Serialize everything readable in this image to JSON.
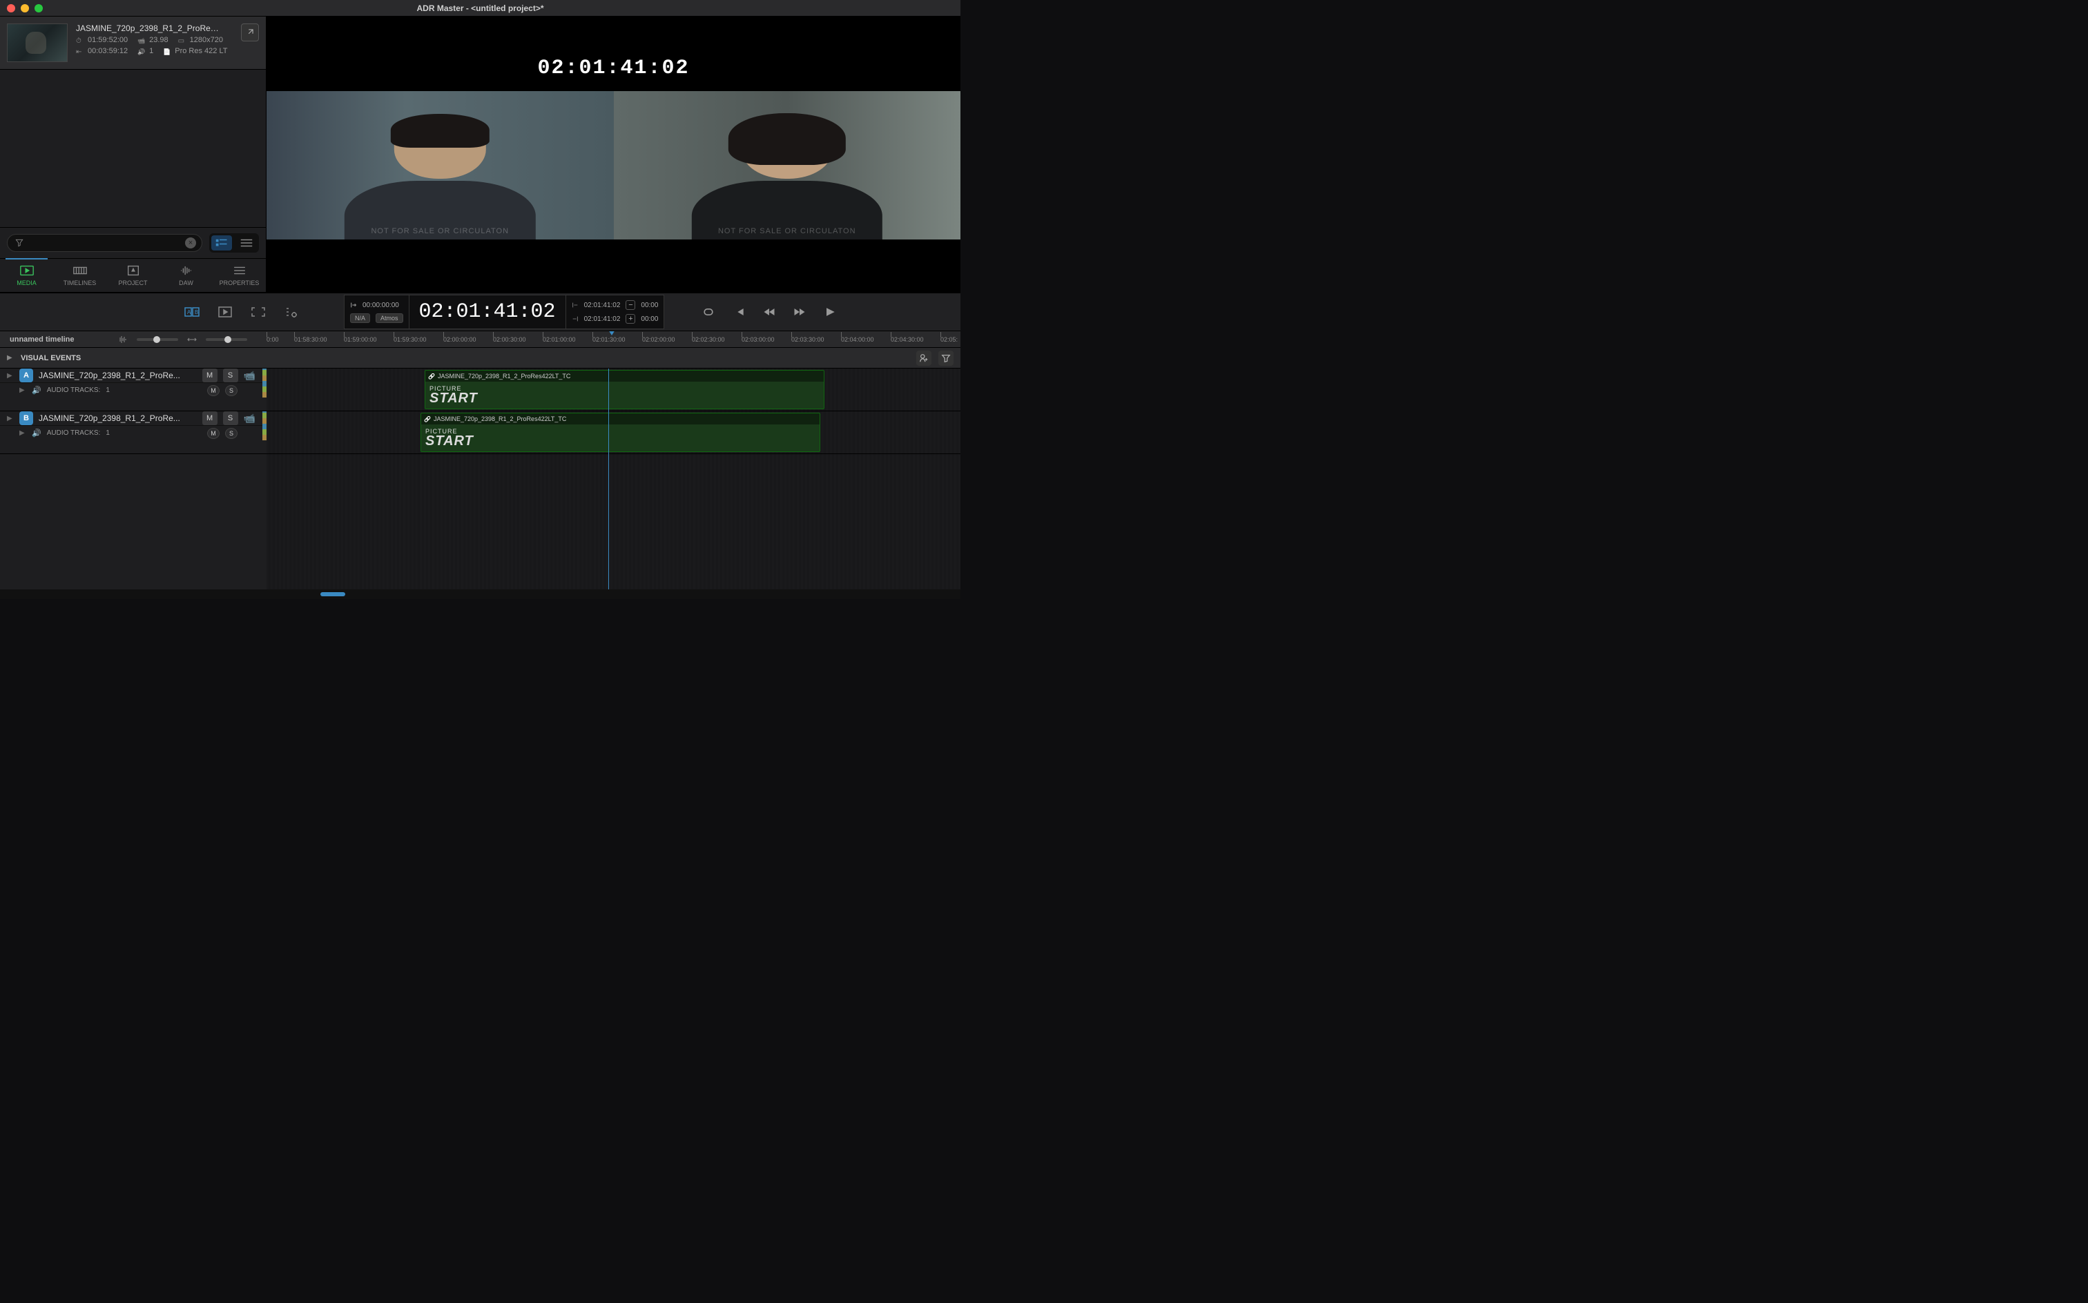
{
  "window": {
    "title": "ADR Master - <untitled project>*"
  },
  "media_item": {
    "name": "JASMINE_720p_2398_R1_2_ProRes422L...",
    "start_tc": "01:59:52:00",
    "fps": "23.98",
    "resolution": "1280x720",
    "duration": "00:03:59:12",
    "audio_channels": "1",
    "codec": "Pro Res 422 LT"
  },
  "tabs": {
    "media": "MEDIA",
    "timelines": "TIMELINES",
    "project": "PROJECT",
    "daw": "DAW",
    "properties": "PROPERTIES"
  },
  "viewer": {
    "timecode": "02:01:41:02",
    "watermark": "NOT FOR SALE OR CIRCULATON"
  },
  "transport": {
    "in_tc": "00:00:00:00",
    "na": "N/A",
    "atmos": "Atmos",
    "main_tc": "02:01:41:02",
    "mark_in": "02:01:41:02",
    "mark_out": "02:01:41:02",
    "offset_a": "00:00",
    "offset_b": "00:00"
  },
  "timeline": {
    "name": "unnamed timeline",
    "ruler": [
      "0:00",
      "01:58:30:00",
      "01:59:00:00",
      "01:59:30:00",
      "02:00:00:00",
      "02:00:30:00",
      "02:01:00:00",
      "02:01:30:00",
      "02:02:00:00",
      "02:02:30:00",
      "02:03:00:00",
      "02:03:30:00",
      "02:04:00:00",
      "02:04:30:00",
      "02:05:"
    ]
  },
  "visual_events": {
    "title": "VISUAL EVENTS"
  },
  "tracks": [
    {
      "ch": "A",
      "name": "JASMINE_720p_2398_R1_2_ProRe...",
      "mute": "M",
      "solo": "S",
      "audio_label": "AUDIO TRACKS:",
      "audio_count": "1",
      "clip_label": "JASMINE_720p_2398_R1_2_ProRes422LT_TC",
      "pic_small": "PICTURE",
      "pic_big": "START"
    },
    {
      "ch": "B",
      "name": "JASMINE_720p_2398_R1_2_ProRe...",
      "mute": "M",
      "solo": "S",
      "audio_label": "AUDIO TRACKS:",
      "audio_count": "1",
      "clip_label": "JASMINE_720p_2398_R1_2_ProRes422LT_TC",
      "pic_small": "PICTURE",
      "pic_big": "START"
    }
  ]
}
